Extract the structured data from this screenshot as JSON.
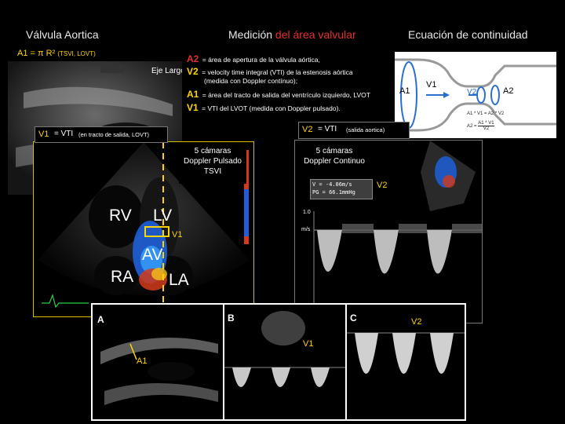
{
  "titles": {
    "left": "Válvula Aortica",
    "center_prefix": "Medición ",
    "center_highlight": "del área valvular",
    "right": "Ecuación de continuidad"
  },
  "formula": {
    "prefix": "A1 = π R²",
    "note": "(TSVI, LOVT)"
  },
  "eje_largo": "Eje Largo",
  "definitions": [
    {
      "sym": "A2",
      "text": "= área de apertura de la válvula aórtica,"
    },
    {
      "sym": "V2",
      "text": "= velocity time integral (VTI) de la estenosis aórtica"
    },
    {
      "sym": "",
      "text": "(medida con Doppler contínuo);"
    },
    {
      "sym": "A1",
      "text": "= área del tracto de salida del ventrículo izquierdo, LVOT"
    },
    {
      "sym": "V1",
      "text": "= VTI del LVOT (medida con Doppler pulsado)."
    }
  ],
  "v1_label": {
    "sym": "V1",
    "text": "= VTI",
    "note": "(en tracto de salida, LOVT)"
  },
  "v2_label": {
    "sym": "V2",
    "text": "= VTI",
    "note": "(salida aortica)"
  },
  "pulsed": {
    "line1": "5 cámaras",
    "line2": "Doppler Pulsado",
    "line3": "TSVI"
  },
  "continuous": {
    "line1": "5 cámaras",
    "line2": "Doppler Continuo"
  },
  "measurement": {
    "v": "V = -4.06m/s",
    "pg": "PG = 66.1mmHg"
  },
  "scale": {
    "top": "1.0",
    "unit": "m/s"
  },
  "chambers": {
    "rv": "RV",
    "lv": "LV",
    "av": "AV",
    "ra": "RA",
    "la": "LA"
  },
  "diagram": {
    "a1": "A1",
    "v1": "V1",
    "v2": "V2",
    "a2": "A2",
    "eq1": "A1 * V1 = A2 * V2",
    "eq2a": "A1 * V1",
    "eq2b": "V2",
    "eq2lhs": "A2 ="
  },
  "tags": {
    "v1_mid": "V1",
    "v2_mid": "V2",
    "a1_bot": "A1",
    "v1_bot": "V1",
    "v2_bot": "V2"
  },
  "panels": {
    "a": "A",
    "b": "B",
    "c": "C"
  }
}
